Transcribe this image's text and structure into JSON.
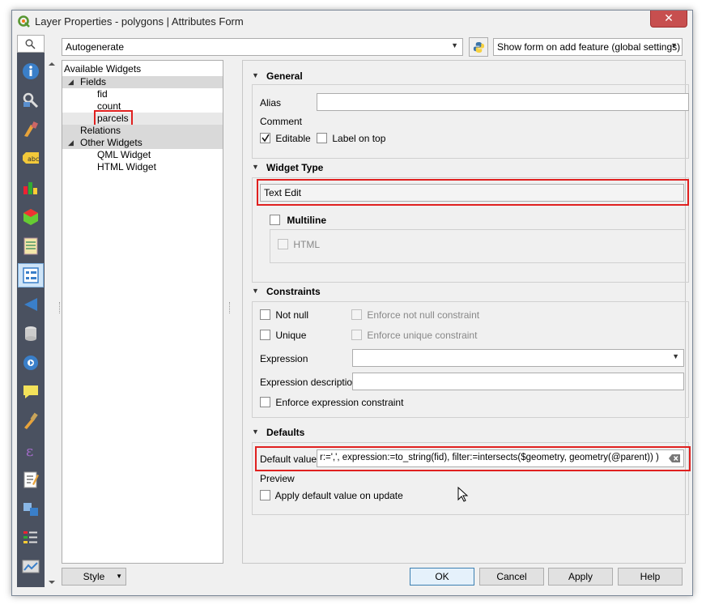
{
  "window": {
    "title": "Layer Properties - polygons | Attributes Form",
    "close_glyph": "✕"
  },
  "toolbar": {
    "layout_combo": "Autogenerate",
    "python_icon": "python-icon",
    "form_combo": "Show form on add feature (global settings)"
  },
  "sidebar_tabs": [
    "information-icon",
    "source-icon",
    "symbology-icon",
    "labels-icon",
    "diagrams-icon",
    "3d-view-icon",
    "fields-icon",
    "attributes-form-icon",
    "joins-icon",
    "auxiliary-storage-icon",
    "actions-icon",
    "display-icon",
    "rendering-icon",
    "variables-icon",
    "metadata-icon",
    "dependencies-icon",
    "legend-icon",
    "qgis-server-icon"
  ],
  "tree": {
    "header": "Available Widgets",
    "fields_group": "Fields",
    "fields": [
      "fid",
      "count",
      "parcels"
    ],
    "relations_group": "Relations",
    "other_group": "Other Widgets",
    "other": [
      "QML Widget",
      "HTML Widget"
    ]
  },
  "general": {
    "title": "General",
    "alias_label": "Alias",
    "alias_value": "",
    "comment_label": "Comment",
    "editable_label": "Editable",
    "editable_checked": true,
    "label_on_top_label": "Label on top",
    "label_on_top_checked": false
  },
  "widget_type": {
    "title": "Widget Type",
    "value": "Text Edit",
    "multiline_label": "Multiline",
    "html_label": "HTML"
  },
  "constraints": {
    "title": "Constraints",
    "not_null_label": "Not null",
    "enforce_not_null_label": "Enforce not null constraint",
    "unique_label": "Unique",
    "enforce_unique_label": "Enforce unique constraint",
    "expression_label": "Expression",
    "expression_value": "",
    "expression_desc_label": "Expression description",
    "expression_desc_value": "",
    "enforce_expression_label": "Enforce expression constraint"
  },
  "defaults": {
    "title": "Defaults",
    "default_value_label": "Default value",
    "default_value": "r:=',',  expression:=to_string(fid),  filter:=intersects($geometry, geometry(@parent))  )",
    "clear_icon": "clear-icon",
    "preview_label": "Preview",
    "apply_on_update_label": "Apply default value on update"
  },
  "buttons": {
    "style": "Style",
    "ok": "OK",
    "cancel": "Cancel",
    "apply": "Apply",
    "help": "Help"
  }
}
